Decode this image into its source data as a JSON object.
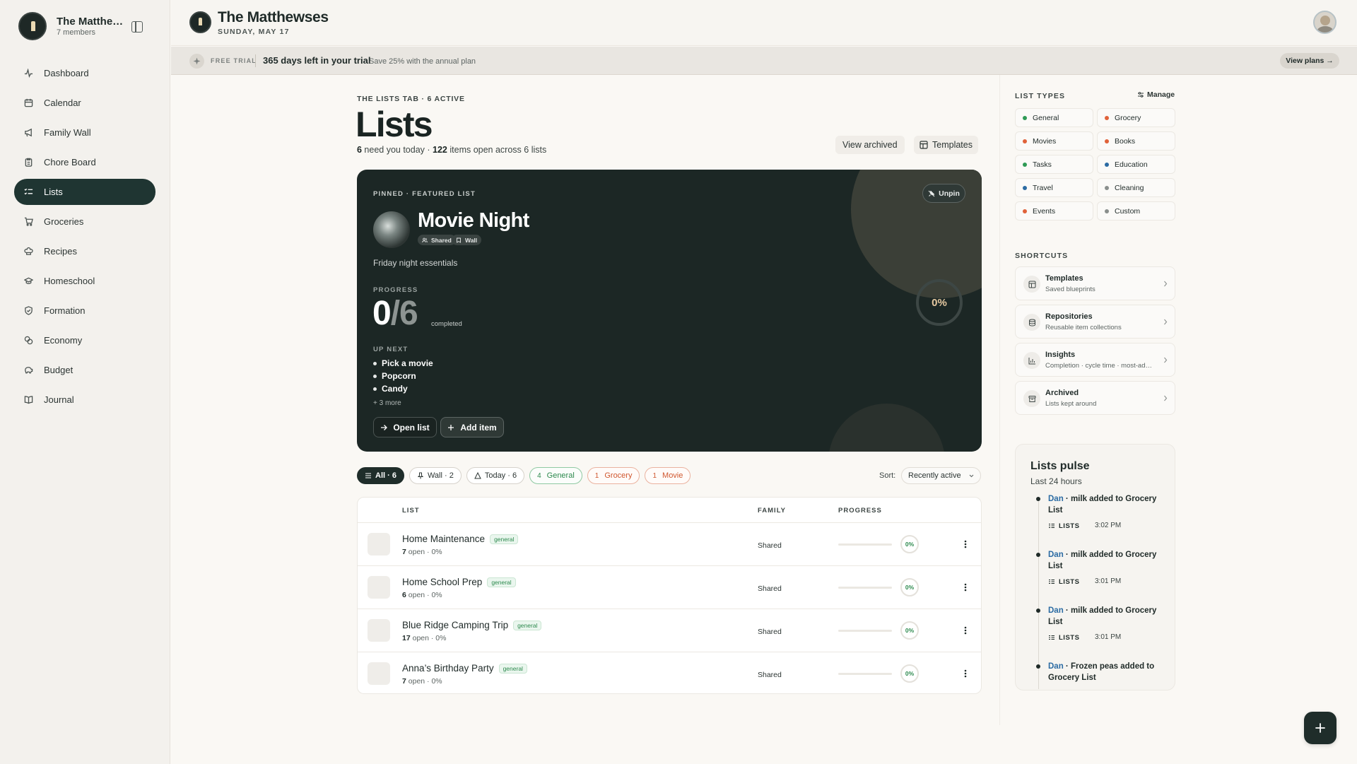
{
  "sidebar": {
    "family_name": "The Matthe…",
    "members": "7 members",
    "items": [
      {
        "label": "Dashboard",
        "icon": "pulse-icon"
      },
      {
        "label": "Calendar",
        "icon": "calendar-icon"
      },
      {
        "label": "Family Wall",
        "icon": "megaphone-icon"
      },
      {
        "label": "Chore Board",
        "icon": "clipboard-icon"
      },
      {
        "label": "Lists",
        "icon": "list-icon",
        "active": true
      },
      {
        "label": "Groceries",
        "icon": "cart-icon"
      },
      {
        "label": "Recipes",
        "icon": "chef-hat-icon"
      },
      {
        "label": "Homeschool",
        "icon": "graduation-cap-icon"
      },
      {
        "label": "Formation",
        "icon": "shield-icon"
      },
      {
        "label": "Economy",
        "icon": "coins-icon"
      },
      {
        "label": "Budget",
        "icon": "piggy-bank-icon"
      },
      {
        "label": "Journal",
        "icon": "book-icon"
      }
    ]
  },
  "header": {
    "title": "The Matthewses",
    "date": "SUNDAY, MAY 17"
  },
  "trial": {
    "label": "FREE TRIAL",
    "days": "365 days left in your trial",
    "offer": "Save 25% with the annual plan",
    "button": "View plans →"
  },
  "main": {
    "eyebrow": "THE LISTS TAB · 6 ACTIVE",
    "title": "Lists",
    "summary_need": "6",
    "summary_need_text": " need you today · ",
    "summary_items": "122",
    "summary_items_text": " items open across 6 lists",
    "view_archived": "View archived",
    "templates": "Templates"
  },
  "featured": {
    "eyebrow": "PINNED · FEATURED LIST",
    "unpin": "Unpin",
    "title": "Movie Night",
    "chip_shared": "Shared",
    "chip_wall": "Wall",
    "description": "Friday night essentials",
    "progress_label": "PROGRESS",
    "done": "0",
    "total": "6",
    "completed_label": "completed",
    "percent": "0%",
    "up_next_label": "UP NEXT",
    "up_next": [
      "Pick a movie",
      "Popcorn",
      "Candy"
    ],
    "more": "+ 3 more",
    "open_button": "Open list",
    "add_button": "Add item",
    "colors": {
      "card": "#1c2725",
      "ring_text": "#e6c9a1"
    }
  },
  "filters": {
    "all": "All · 6",
    "wall": "Wall · 2",
    "today": "Today · 6",
    "general_count": "4",
    "general": "General",
    "grocery_count": "1",
    "grocery": "Grocery",
    "movie_count": "1",
    "movie": "Movie",
    "sort_label": "Sort:",
    "sort_value": "Recently active"
  },
  "table": {
    "headers": {
      "list": "LIST",
      "family": "FAMILY",
      "progress": "PROGRESS"
    },
    "rows": [
      {
        "name": "Home Maintenance",
        "tag": "general",
        "open": "7",
        "meta": " open · 0%",
        "family": "Shared",
        "percent": "0%",
        "progress": 0
      },
      {
        "name": "Home School Prep",
        "tag": "general",
        "open": "6",
        "meta": " open · 0%",
        "family": "Shared",
        "percent": "0%",
        "progress": 0
      },
      {
        "name": "Blue Ridge Camping Trip",
        "tag": "general",
        "open": "17",
        "meta": " open · 0%",
        "family": "Shared",
        "percent": "0%",
        "progress": 0
      },
      {
        "name": "Anna’s Birthday Party",
        "tag": "general",
        "open": "7",
        "meta": " open · 0%",
        "family": "Shared",
        "percent": "0%",
        "progress": 0
      }
    ]
  },
  "list_types": {
    "title": "LIST TYPES",
    "manage": "Manage",
    "items": [
      {
        "label": "General",
        "color": "#2e9a55"
      },
      {
        "label": "Grocery",
        "color": "#e0623a"
      },
      {
        "label": "Movies",
        "color": "#e0623a"
      },
      {
        "label": "Books",
        "color": "#e0623a"
      },
      {
        "label": "Tasks",
        "color": "#2e9a55"
      },
      {
        "label": "Education",
        "color": "#2b6ba3"
      },
      {
        "label": "Travel",
        "color": "#2b6ba3"
      },
      {
        "label": "Cleaning",
        "color": "#8a8f8d"
      },
      {
        "label": "Events",
        "color": "#e0623a"
      },
      {
        "label": "Custom",
        "color": "#8a8f8d"
      }
    ]
  },
  "shortcuts": {
    "title": "SHORTCUTS",
    "items": [
      {
        "name": "Templates",
        "sub": "Saved blueprints",
        "icon": "template-icon"
      },
      {
        "name": "Repositories",
        "sub": "Reusable item collections",
        "icon": "database-icon"
      },
      {
        "name": "Insights",
        "sub": "Completion · cycle time · most-ad…",
        "icon": "chart-icon"
      },
      {
        "name": "Archived",
        "sub": "Lists kept around",
        "icon": "archive-icon"
      }
    ]
  },
  "pulse": {
    "title": "Lists pulse",
    "subtitle": "Last 24 hours",
    "events": [
      {
        "who": "Dan",
        "text": " · milk added to Grocery List",
        "tag": "LISTS",
        "time": "3:02 PM"
      },
      {
        "who": "Dan",
        "text": " · milk added to Grocery List",
        "tag": "LISTS",
        "time": "3:01 PM"
      },
      {
        "who": "Dan",
        "text": " · milk added to Grocery List",
        "tag": "LISTS",
        "time": "3:01 PM"
      },
      {
        "who": "Dan",
        "text": " · Frozen peas added to Grocery List",
        "tag": "",
        "time": ""
      }
    ]
  }
}
